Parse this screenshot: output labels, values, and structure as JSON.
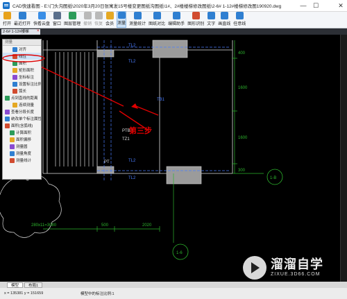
{
  "window": {
    "title": "CAD快速看图 - E:\\门头沟图纸\\2020年3月20日张寓发15号楼变更图纸沟图纸\\1#、2#楼楼梯修改图纸\\2-6# 1-12#楼梯修改图190920.dwg",
    "minimize_glyph": "—",
    "maximize_glyph": "☐",
    "close_glyph": "✕"
  },
  "toolbar": {
    "items": [
      {
        "label": "打开",
        "icon": "folder-icon",
        "color": "#e8a21c"
      },
      {
        "label": "最近打开",
        "icon": "recent-icon",
        "color": "#2f7fd1"
      },
      {
        "label": "快看云盘",
        "icon": "cloud-icon",
        "color": "#3a8ee6"
      },
      {
        "label": "窗口",
        "icon": "window-icon",
        "color": "#5a6f8c"
      },
      {
        "label": "图层管理",
        "icon": "layers-icon",
        "color": "#2c9c5a"
      },
      {
        "label": "撤销",
        "icon": "undo-icon",
        "color": "#b9b9b9"
      },
      {
        "label": "恢复",
        "icon": "redo-icon",
        "color": "#b9b9b9"
      },
      {
        "label": "会员",
        "icon": "vip-icon",
        "color": "#e5a823"
      },
      {
        "label": "测量",
        "icon": "measure-icon",
        "color": "#2f7fd1"
      },
      {
        "label": "测量统计",
        "icon": "measure-stats-icon",
        "color": "#2f7fd1"
      },
      {
        "label": "图纸对比",
        "icon": "compare-icon",
        "color": "#2f7fd1"
      },
      {
        "label": "编辑助手",
        "icon": "edit-assistant-icon",
        "color": "#2f7fd1"
      },
      {
        "label": "图形识别",
        "icon": "shape-recognition-icon",
        "color": "#d14b2f"
      },
      {
        "label": "文字",
        "icon": "text-icon",
        "color": "#2f7fd1"
      },
      {
        "label": "画直线",
        "icon": "line-icon",
        "color": "#2f7fd1"
      },
      {
        "label": "任意线",
        "icon": "freeline-icon",
        "color": "#2f7fd1"
      }
    ]
  },
  "doc_tab": {
    "label": "2-6# 1-12#楼梯",
    "close_glyph": "×"
  },
  "measure_panel": {
    "header": "测量",
    "items": [
      {
        "label": "对齐",
        "icon": "align-icon",
        "selected": false,
        "indent": 1
      },
      {
        "label": "线性",
        "icon": "linear-icon",
        "selected": true,
        "indent": 1
      },
      {
        "label": "面积",
        "icon": "area-icon",
        "selected": false,
        "indent": 1
      },
      {
        "label": "矩形面积",
        "icon": "rect-area-icon",
        "selected": false,
        "indent": 1
      },
      {
        "label": "坐标标注",
        "icon": "coordinate-icon",
        "selected": false,
        "indent": 1
      },
      {
        "label": "设置标注比例",
        "icon": "scale-icon",
        "selected": false,
        "indent": 1
      },
      {
        "label": "弧长",
        "icon": "arc-icon",
        "selected": false,
        "indent": 1
      },
      {
        "label": "点到直线的距离",
        "icon": "point-line-icon",
        "selected": false,
        "indent": 0
      },
      {
        "label": "连续测量",
        "icon": "continuous-icon",
        "selected": false,
        "indent": 1
      },
      {
        "label": "查看分段长度",
        "icon": "segment-icon",
        "selected": false,
        "indent": 0
      },
      {
        "label": "统改单个标注属性",
        "icon": "modify-icon",
        "selected": false,
        "indent": 0
      },
      {
        "label": "面积(含弧线)",
        "icon": "arc-area-icon",
        "selected": false,
        "indent": 0
      },
      {
        "label": "计算面积",
        "icon": "calc-area-icon",
        "selected": false,
        "indent": 2
      },
      {
        "label": "面积偏移",
        "icon": "offset-icon",
        "selected": false,
        "indent": 2
      },
      {
        "label": "测量圆",
        "icon": "circle-icon",
        "selected": false,
        "indent": 2
      },
      {
        "label": "测量角度",
        "icon": "angle-icon",
        "selected": false,
        "indent": 2
      },
      {
        "label": "测量线计",
        "icon": "line-count-icon",
        "selected": false,
        "indent": 2
      }
    ]
  },
  "annotation": {
    "step_label": "第三步",
    "color": "#e00000"
  },
  "drawing": {
    "dims_right": [
      "400",
      "1600",
      "1600",
      "300"
    ],
    "dims_bottom": [
      "280x11=3080",
      "500",
      "2020"
    ],
    "grid_bubbles": [
      "1-B",
      "1-6"
    ],
    "labels": [
      "TL2",
      "TL2",
      "TB1",
      "TL2",
      "TL2",
      "PTB2",
      "TZ1",
      "PT"
    ]
  },
  "layout_tabs": [
    "模型",
    "布局1"
  ],
  "status": {
    "coords": "x = 135381  y = 151659",
    "scale": "模型中的标注比例:1"
  },
  "watermark": {
    "name": "溜溜自学",
    "url": "ZIXUE.3D66.COM"
  }
}
